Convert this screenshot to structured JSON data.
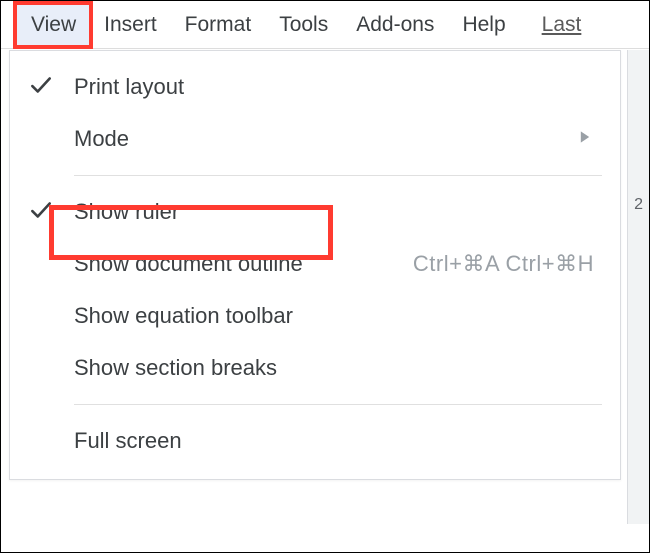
{
  "menubar": {
    "view": "View",
    "insert": "Insert",
    "format": "Format",
    "tools": "Tools",
    "addons": "Add-ons",
    "help": "Help",
    "last": "Last"
  },
  "dropdown": {
    "print_layout": "Print layout",
    "mode": "Mode",
    "show_ruler": "Show ruler",
    "show_document_outline": "Show document outline",
    "show_document_outline_shortcut": "Ctrl+⌘A Ctrl+⌘H",
    "show_equation_toolbar": "Show equation toolbar",
    "show_section_breaks": "Show section breaks",
    "full_screen": "Full screen"
  },
  "page_edge": {
    "indicator": "2"
  }
}
